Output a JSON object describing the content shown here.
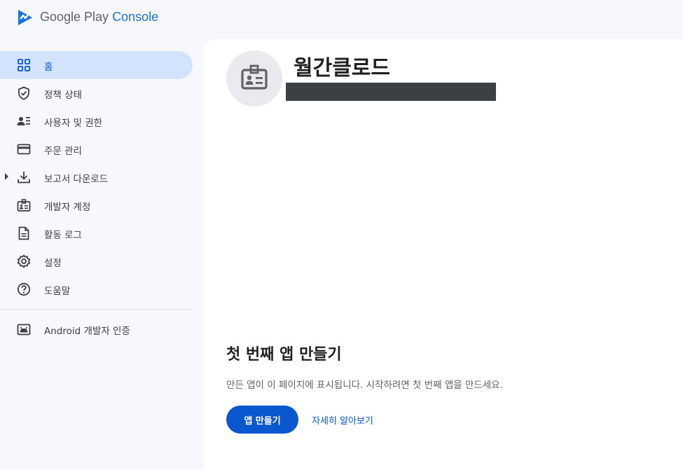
{
  "header": {
    "logo_icon": "play-console-logo-icon",
    "brand_prefix": "Google Play ",
    "brand_accent": "Console"
  },
  "sidebar": {
    "items": [
      {
        "label": "홈",
        "icon": "grid-icon",
        "active": true
      },
      {
        "label": "정책 상태",
        "icon": "shield-check-icon"
      },
      {
        "label": "사용자 및 권한",
        "icon": "person-list-icon"
      },
      {
        "label": "주문 관리",
        "icon": "credit-card-icon"
      },
      {
        "label": "보고서 다운로드",
        "icon": "download-icon",
        "expandable": true
      },
      {
        "label": "개발자 계정",
        "icon": "badge-icon"
      },
      {
        "label": "활동 로그",
        "icon": "document-icon"
      },
      {
        "label": "설정",
        "icon": "gear-icon"
      },
      {
        "label": "도움말",
        "icon": "help-icon"
      },
      {
        "label": "Android 개발자 인증",
        "icon": "android-icon"
      }
    ]
  },
  "account": {
    "name": "월간클로드",
    "avatar_icon": "badge-icon"
  },
  "empty_state": {
    "title": "첫 번째 앱 만들기",
    "description": "만든 앱이 이 페이지에 표시됩니다. 시작하려면 첫 번째 앱을 만드세요.",
    "primary_button": "앱 만들기",
    "link": "자세히 알아보기"
  },
  "colors": {
    "accent": "#0b57d0",
    "active_nav_bg": "#d3e3fd",
    "sidebar_bg": "#f7f8fc",
    "main_bg": "#ffffff"
  }
}
